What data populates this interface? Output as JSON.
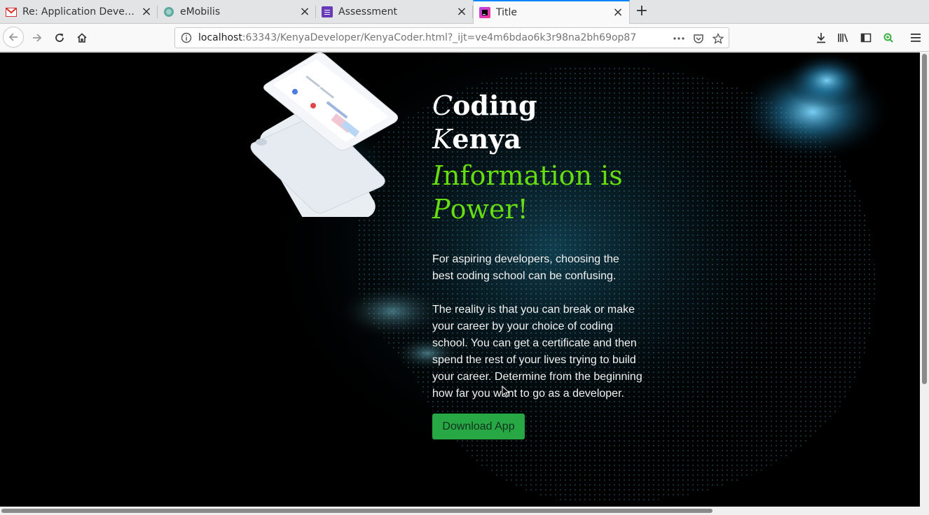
{
  "tabs": [
    {
      "title": "Re: Application Develop",
      "favicon": "gmail-icon"
    },
    {
      "title": "eMobilis",
      "favicon": "emobilis-icon"
    },
    {
      "title": "Assessment",
      "favicon": "form-icon"
    },
    {
      "title": "Title",
      "favicon": "phpstorm-icon"
    }
  ],
  "address": {
    "host": "localhost",
    "path": ":63343/KenyaDeveloper/KenyaCoder.html?_ijt=ve4m6bdao6k3r98na2bh69op87"
  },
  "page": {
    "title_line1_cap": "C",
    "title_line1_rest": "oding",
    "title_line2_cap": "K",
    "title_line2_rest": "enya",
    "tagline_cap1": "I",
    "tagline_rest1": "nformation is",
    "tagline_cap2": "P",
    "tagline_rest2": "ower!",
    "paragraph1": "For aspiring developers, choosing the best coding school can be confusing.",
    "paragraph2": "The reality is that you can break or make your career by your choice of coding school. You can get a certificate and then spend the rest of your lives trying to build your career. Determine from the beginning how far you want to go as a developer.",
    "download_button": "Download App"
  },
  "colors": {
    "accent_green": "#66dd10",
    "button_green": "#28a745",
    "tab_active_indicator": "#0a84ff"
  }
}
